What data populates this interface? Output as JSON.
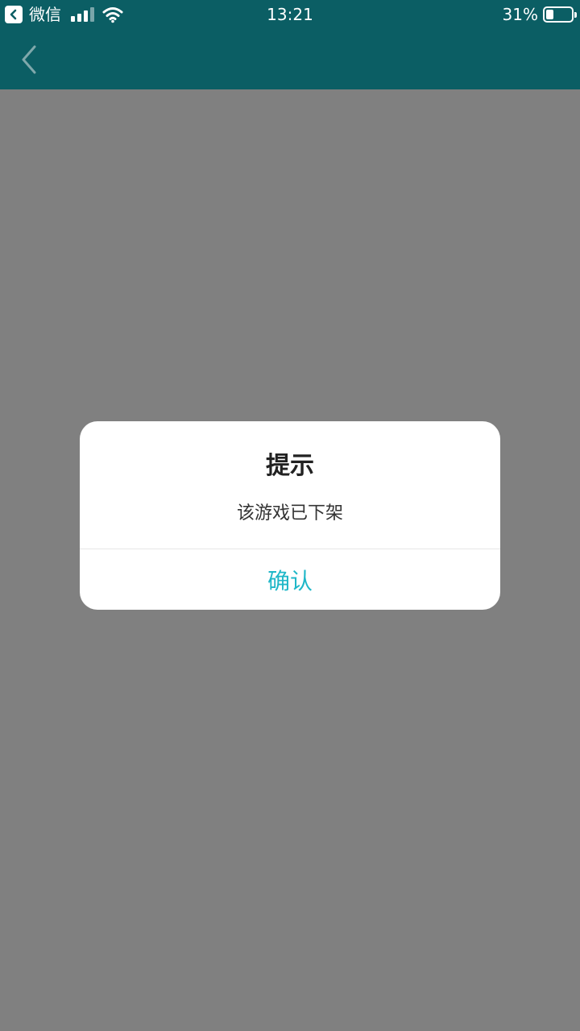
{
  "status_bar": {
    "app_name": "微信",
    "time": "13:21",
    "battery_percent": "31%",
    "battery_level": 0.31,
    "icons": [
      "back-to-app-icon",
      "signal-icon",
      "wifi-icon",
      "battery-icon"
    ]
  },
  "nav": {
    "back_icon": "chevron-left-icon"
  },
  "dialog": {
    "title": "提示",
    "message": "该游戏已下架",
    "confirm_label": "确认"
  },
  "colors": {
    "header_bg": "#0b5e64",
    "overlay_bg": "#808080",
    "dialog_bg": "#ffffff",
    "accent": "#1fb7c8"
  }
}
